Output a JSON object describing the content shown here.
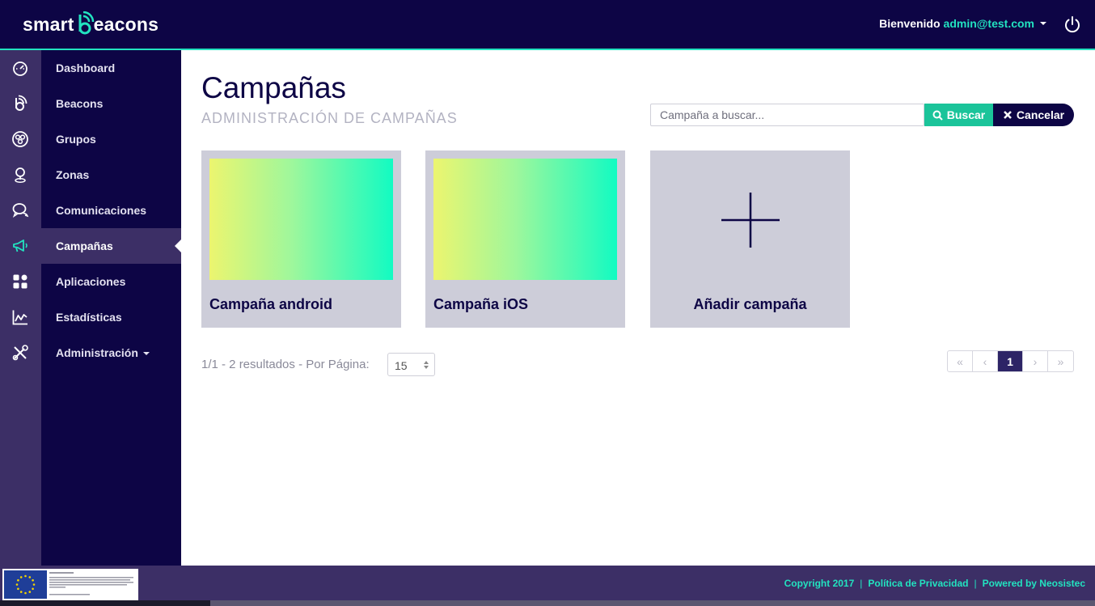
{
  "header": {
    "logo_left": "smart",
    "logo_right": "eacons",
    "welcome": "Bienvenido",
    "email": "admin@test.com"
  },
  "sidebar": {
    "items": [
      {
        "label": "Dashboard",
        "icon": "dashboard-icon"
      },
      {
        "label": "Beacons",
        "icon": "beacon-icon"
      },
      {
        "label": "Grupos",
        "icon": "groups-icon"
      },
      {
        "label": "Zonas",
        "icon": "zone-pin-icon"
      },
      {
        "label": "Comunicaciones",
        "icon": "chat-icon"
      },
      {
        "label": "Campañas",
        "icon": "megaphone-icon",
        "active": true
      },
      {
        "label": "Aplicaciones",
        "icon": "apps-grid-icon"
      },
      {
        "label": "Estadísticas",
        "icon": "stats-icon"
      },
      {
        "label": "Administración",
        "icon": "tools-icon"
      }
    ]
  },
  "main": {
    "title": "Campañas",
    "subtitle": "ADMINISTRACIÓN DE CAMPAÑAS",
    "search": {
      "placeholder": "Campaña a buscar...",
      "value": ""
    },
    "search_button": "Buscar",
    "cancel_button": "Cancelar",
    "cards": [
      {
        "name": "Campaña android"
      },
      {
        "name": "Campaña iOS"
      }
    ],
    "add_card": "Añadir campaña",
    "results_text": "1/1 - 2 resultados - Por Página:",
    "per_page": "15",
    "pagination": {
      "first": "«",
      "prev": "‹",
      "current": "1",
      "next": "›",
      "last": "»"
    }
  },
  "footer": {
    "copyright": "Copyright 2017",
    "privacy": "Política de Privacidad",
    "powered": "Powered by Neosistec"
  },
  "colors": {
    "navy": "#0d0545",
    "rail": "#3c2f66",
    "accent": "#22e3c0",
    "button_green": "#1bc49a"
  }
}
